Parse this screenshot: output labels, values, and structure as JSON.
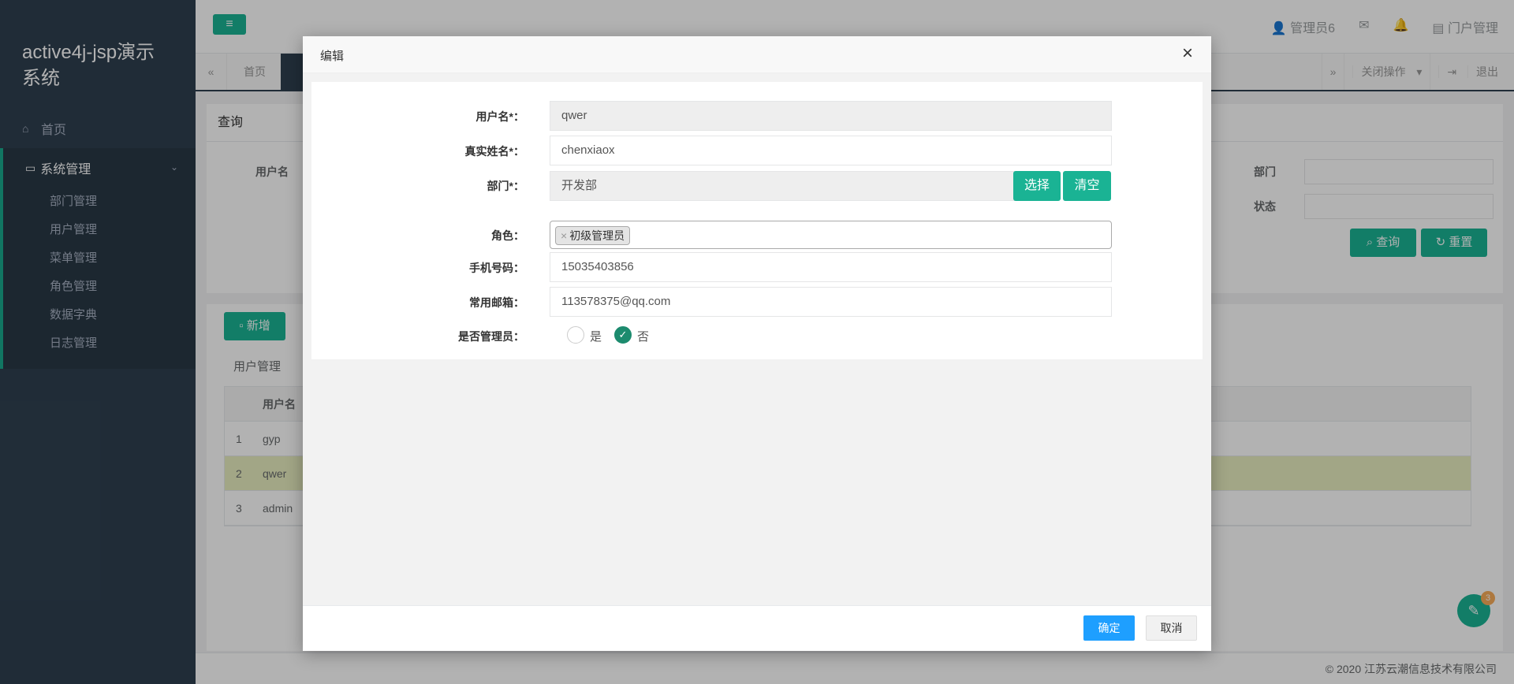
{
  "sidebar": {
    "brand": "active4j-jsp演示系统",
    "home": "首页",
    "group": "系统管理",
    "items": [
      "部门管理",
      "用户管理",
      "菜单管理",
      "角色管理",
      "数据字典",
      "日志管理"
    ]
  },
  "topbar": {
    "user": "管理员6",
    "portal": "门户管理"
  },
  "tabs": {
    "home": "首页",
    "close_ops": "关闭操作",
    "logout": "退出"
  },
  "query": {
    "title": "查询",
    "username_label": "用户名",
    "dept_label": "部门",
    "status_label": "状态",
    "search_btn": "查询",
    "reset_btn": "重置"
  },
  "list": {
    "new_btn": "新增",
    "title": "用户管理",
    "col_username": "用户名",
    "rows": [
      {
        "idx": "1",
        "name": "gyp"
      },
      {
        "idx": "2",
        "name": "qwer"
      },
      {
        "idx": "3",
        "name": "admin"
      }
    ]
  },
  "footer": "© 2020 江苏云潮信息技术有限公司",
  "chat_badge": "3",
  "modal": {
    "title": "编辑",
    "username_label": "用户名*：",
    "username": "qwer",
    "realname_label": "真实姓名*：",
    "realname": "chenxiaox",
    "dept_label": "部门*：",
    "dept": "开发部",
    "select_btn": "选择",
    "clear_btn": "清空",
    "role_label": "角色：",
    "role_tag": "初级管理员",
    "phone_label": "手机号码：",
    "phone": "15035403856",
    "email_label": "常用邮箱：",
    "email": "113578375@qq.com",
    "admin_label": "是否管理员：",
    "yes": "是",
    "no": "否",
    "ok_btn": "确定",
    "cancel_btn": "取消"
  }
}
